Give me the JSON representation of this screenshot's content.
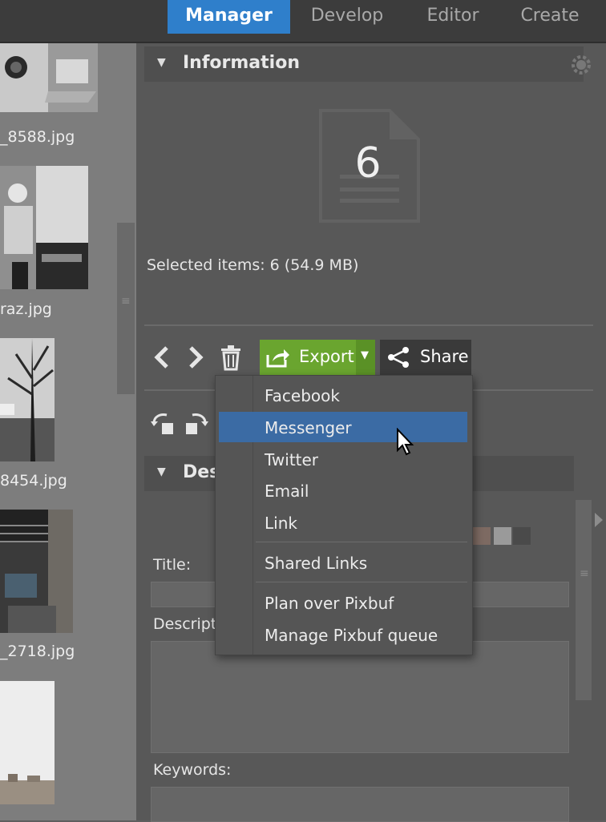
{
  "tabs": [
    {
      "label": "Manager",
      "active": true
    },
    {
      "label": "Develop",
      "active": false
    },
    {
      "label": "Editor",
      "active": false
    },
    {
      "label": "Create",
      "active": false
    }
  ],
  "filmstrip": {
    "files": [
      "_8588.jpg",
      "raz.jpg",
      "8454.jpg",
      "_2718.jpg"
    ]
  },
  "information": {
    "title": "Information",
    "count": "6",
    "selected_text": "Selected items: 6 (54.9 MB)"
  },
  "toolbar": {
    "export_label": "Export",
    "share_label": "Share"
  },
  "description": {
    "title_partial": "Des",
    "title_label": "Title:",
    "description_label": "Descript",
    "keywords_label": "Keywords:"
  },
  "share_menu": {
    "items": [
      {
        "label": "Facebook",
        "highlighted": false
      },
      {
        "label": "Messenger",
        "highlighted": true
      },
      {
        "label": "Twitter",
        "highlighted": false
      },
      {
        "label": "Email",
        "highlighted": false
      },
      {
        "label": "Link",
        "highlighted": false
      },
      {
        "label": "Shared Links",
        "highlighted": false
      },
      {
        "label": "Plan over Pixbuf",
        "highlighted": false
      },
      {
        "label": "Manage Pixbuf queue",
        "highlighted": false
      }
    ]
  },
  "colors": {
    "accent_blue": "#2f7fcb",
    "export_green": "#6aa52f",
    "menu_highlight": "#3b6ba4"
  }
}
